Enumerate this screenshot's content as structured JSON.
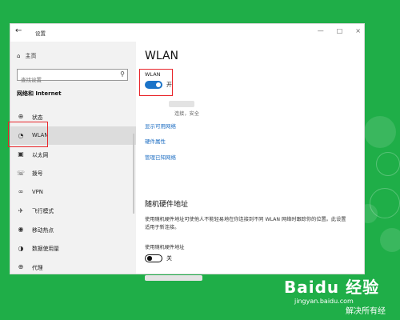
{
  "window": {
    "title": "设置",
    "back_icon": "back-arrow-icon",
    "controls": [
      "—",
      "□",
      "×"
    ]
  },
  "sidebar": {
    "home_label": "主页",
    "search_placeholder": "查找设置",
    "section_title": "网络和 Internet",
    "items": [
      {
        "label": "状态",
        "icon": "globe-icon",
        "glyph": "⊕",
        "active": false
      },
      {
        "label": "WLAN",
        "icon": "wifi-icon",
        "glyph": "◔",
        "active": true
      },
      {
        "label": "以太网",
        "icon": "ethernet-icon",
        "glyph": "▣",
        "active": false
      },
      {
        "label": "拨号",
        "icon": "dialup-icon",
        "glyph": "☏",
        "active": false
      },
      {
        "label": "VPN",
        "icon": "vpn-icon",
        "glyph": "∞",
        "active": false
      },
      {
        "label": "飞行模式",
        "icon": "airplane-icon",
        "glyph": "✈",
        "active": false
      },
      {
        "label": "移动热点",
        "icon": "hotspot-icon",
        "glyph": "◉",
        "active": false
      },
      {
        "label": "数据使用量",
        "icon": "data-usage-icon",
        "glyph": "◑",
        "active": false
      },
      {
        "label": "代理",
        "icon": "proxy-icon",
        "glyph": "⊕",
        "active": false
      }
    ]
  },
  "main": {
    "title": "WLAN",
    "wlan_label": "WLAN",
    "wlan_state": "开",
    "network_status": "连接，安全",
    "links": [
      "显示可用网络",
      "硬件属性",
      "管理已知网络"
    ],
    "random_hw_title": "随机硬件地址",
    "random_hw_desc": "使用随机硬件地址可使他人不能轻易地在你连接到不同 WLAN 网络时跟踪你的位置。此设置适用于新连接。",
    "random_hw_label": "使用随机硬件地址",
    "random_hw_state": "关"
  },
  "watermark": {
    "logo": "Baidu 经验",
    "url": "jingyan.baidu.com",
    "copyright": "解决所有经"
  },
  "colors": {
    "background": "#1fae48",
    "accent": "#1a73c8",
    "highlight": "#e8252a",
    "link": "#1f6fc3"
  }
}
